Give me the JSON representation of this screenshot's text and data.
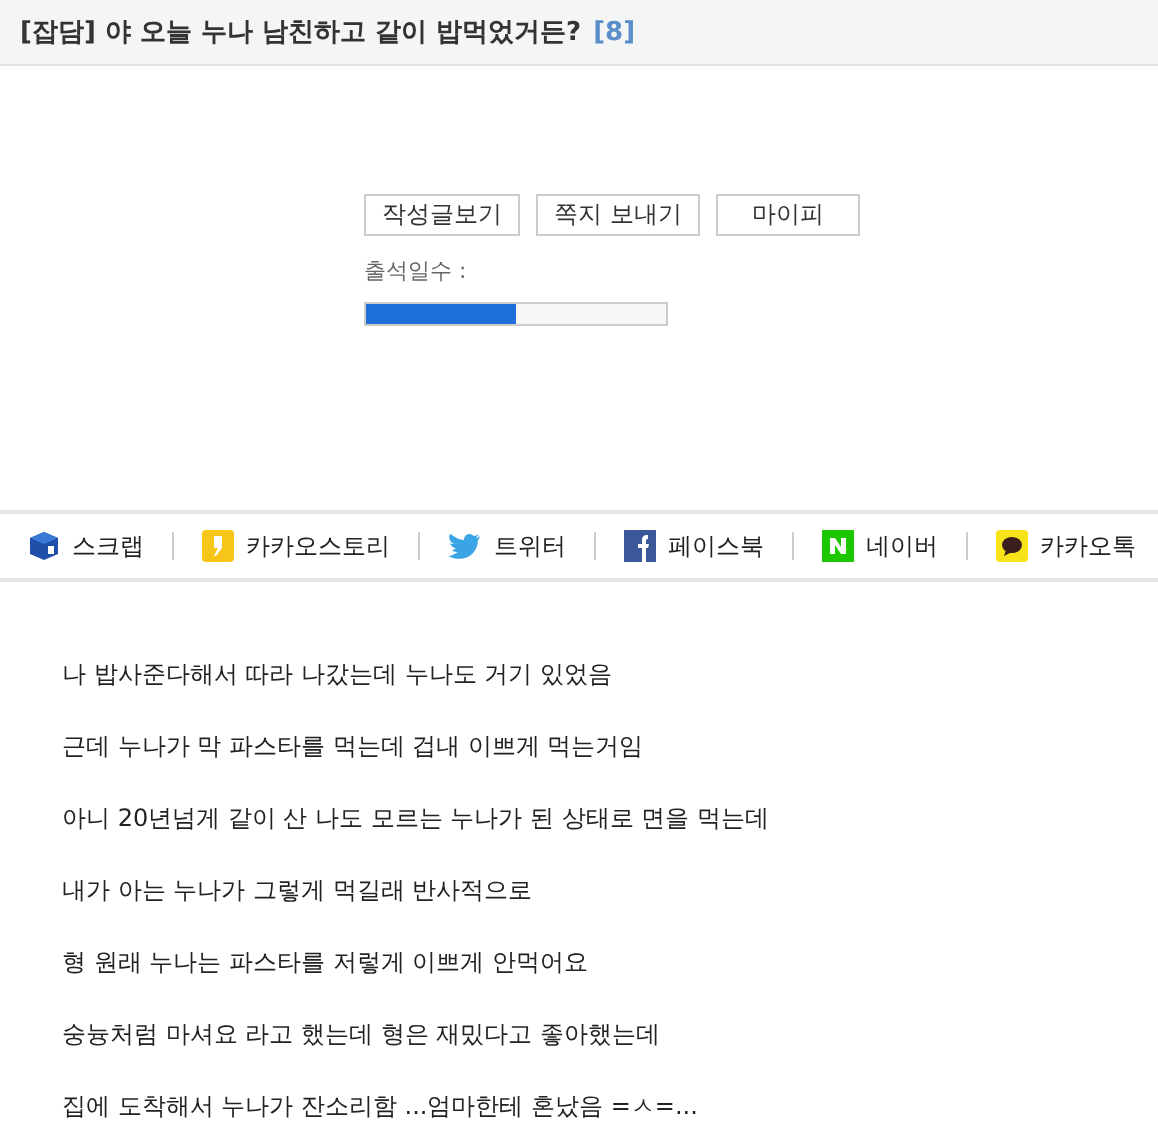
{
  "post": {
    "title": "[잡담] 야 오늘 누나 남친하고 같이 밥먹었거든?",
    "comment_count": "[8]"
  },
  "profile": {
    "buttons": [
      "작성글보기",
      "쪽지 보내기",
      "마이피"
    ],
    "attendance_label": "출석일수 :",
    "attendance": {
      "level": 0.5
    }
  },
  "share": [
    {
      "kind": "scrap",
      "label": "스크랩"
    },
    {
      "kind": "kakaostory",
      "label": "카카오스토리"
    },
    {
      "kind": "twitter",
      "label": "트위터"
    },
    {
      "kind": "facebook",
      "label": "페이스북"
    },
    {
      "kind": "naver",
      "label": "네이버"
    },
    {
      "kind": "kakaotalk",
      "label": "카카오톡"
    }
  ],
  "body": [
    "나 밥사준다해서 따라 나갔는데 누나도 거기 있었음",
    "근데 누나가 막 파스타를 먹는데 겁내 이쁘게 먹는거임",
    "아니 20년넘게 같이 산 나도 모르는 누나가 된 상태로 면을 먹는데",
    "내가 아는 누나가 그렇게 먹길래 반사적으로",
    "형 원래 누나는 파스타를 저렇게 이쁘게 안먹어요",
    "숭늉처럼 마셔요 라고 했는데 형은 재밌다고 좋아했는데",
    "집에 도착해서 누나가 잔소리함 ...엄마한테 혼났음 =ㅅ=..."
  ]
}
